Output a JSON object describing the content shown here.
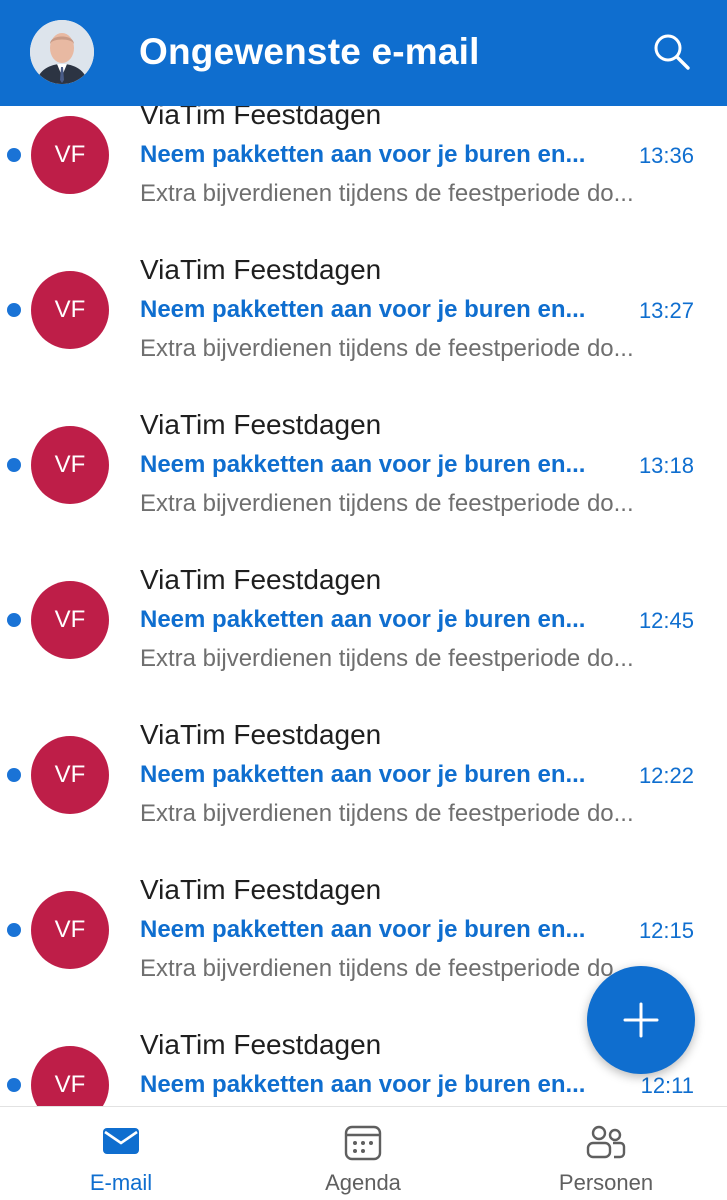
{
  "header": {
    "title": "Ongewenste e-mail",
    "search_icon": "search-icon",
    "avatar_icon": "profile-photo"
  },
  "messages": [
    {
      "sender": "ViaTim Feestdagen",
      "initials": "VF",
      "subject": "Neem pakketten aan voor je buren en...",
      "time": "13:36",
      "preview": "Extra bijverdienen tijdens de feestperiode do...",
      "unread": true
    },
    {
      "sender": "ViaTim Feestdagen",
      "initials": "VF",
      "subject": "Neem pakketten aan voor je buren en...",
      "time": "13:27",
      "preview": "Extra bijverdienen tijdens de feestperiode do...",
      "unread": true
    },
    {
      "sender": "ViaTim Feestdagen",
      "initials": "VF",
      "subject": "Neem pakketten aan voor je buren en...",
      "time": "13:18",
      "preview": "Extra bijverdienen tijdens de feestperiode do...",
      "unread": true
    },
    {
      "sender": "ViaTim Feestdagen",
      "initials": "VF",
      "subject": "Neem pakketten aan voor je buren en...",
      "time": "12:45",
      "preview": "Extra bijverdienen tijdens de feestperiode do...",
      "unread": true
    },
    {
      "sender": "ViaTim Feestdagen",
      "initials": "VF",
      "subject": "Neem pakketten aan voor je buren en...",
      "time": "12:22",
      "preview": "Extra bijverdienen tijdens de feestperiode do...",
      "unread": true
    },
    {
      "sender": "ViaTim Feestdagen",
      "initials": "VF",
      "subject": "Neem pakketten aan voor je buren en...",
      "time": "12:15",
      "preview": "Extra bijverdienen tijdens de feestperiode do...",
      "unread": true
    },
    {
      "sender": "ViaTim Feestdagen",
      "initials": "VF",
      "subject": "Neem pakketten aan voor je buren en...",
      "time": "12:11",
      "preview": "",
      "unread": true
    }
  ],
  "fab": {
    "icon": "plus-icon"
  },
  "nav": [
    {
      "label": "E-mail",
      "icon": "mail-icon",
      "active": true
    },
    {
      "label": "Agenda",
      "icon": "calendar-icon",
      "active": false
    },
    {
      "label": "Personen",
      "icon": "people-icon",
      "active": false
    }
  ],
  "colors": {
    "accent": "#0f6ecf",
    "avatar": "#be1e48",
    "unread_dot": "#1a73d6",
    "preview_text": "#6f6f6f"
  }
}
